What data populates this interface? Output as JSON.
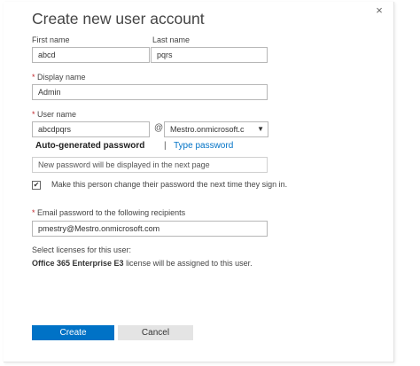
{
  "dialog": {
    "title": "Create new user account",
    "close_glyph": "×"
  },
  "first_name": {
    "label": "First name",
    "value": "abcd"
  },
  "last_name": {
    "label": "Last name",
    "value": "pqrs"
  },
  "display_name": {
    "required": "*",
    "label": "Display name",
    "value": "Admin"
  },
  "user_name": {
    "required": "*",
    "label": "User name",
    "value": "abcdpqrs",
    "at": "@",
    "domain": "Mestro.onmicrosoft.c",
    "caret": "▼"
  },
  "password": {
    "tab_auto": "Auto-generated password",
    "separator": "|",
    "tab_type": "Type password",
    "info": "New password will be displayed in the next page"
  },
  "change_password": {
    "checked": true,
    "check_glyph": "✔",
    "label": "Make this person change their password the next time they sign in."
  },
  "email": {
    "required": "*",
    "label": "Email password to the following recipients",
    "value": "pmestry@Mestro.onmicrosoft.com"
  },
  "licenses": {
    "label": "Select licenses for this user:",
    "product": "Office 365 Enterprise E3",
    "suffix": " license will be assigned to this user."
  },
  "buttons": {
    "create": "Create",
    "cancel": "Cancel"
  },
  "colors": {
    "accent": "#0072c6",
    "required": "#c1272d"
  },
  "icons": {
    "close": "close-icon",
    "dropdown": "chevron-down-icon",
    "checkbox": "checkmark-icon"
  }
}
